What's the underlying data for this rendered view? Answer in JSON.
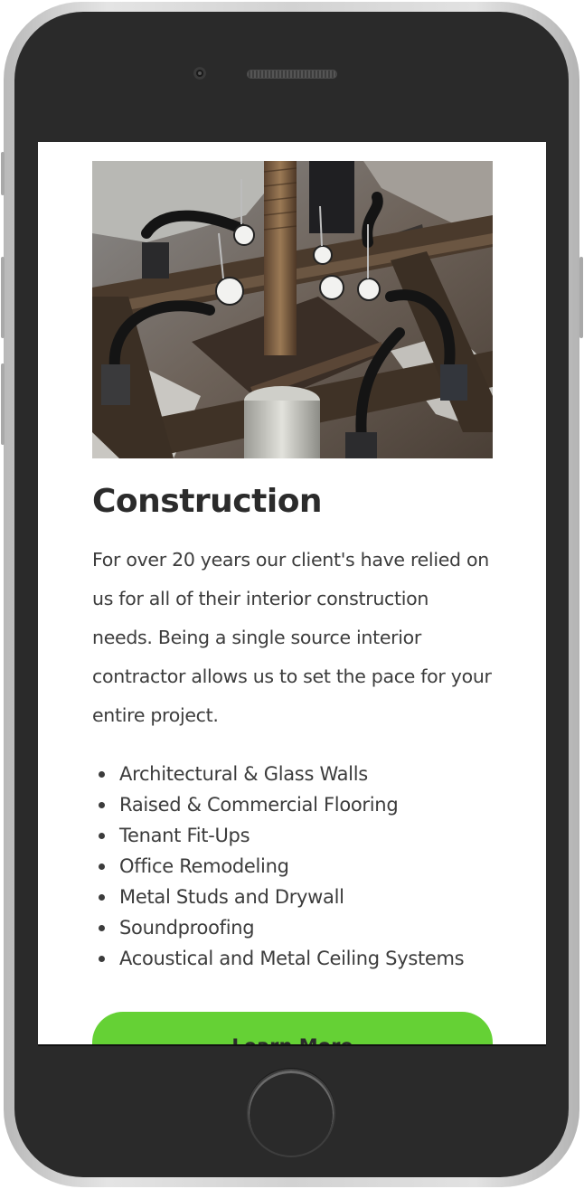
{
  "section": {
    "heading": "Construction",
    "description": "For over 20 years our client's have relied on us for all of their interior construction needs. Being a single source interior contractor allows us to set the pace for your entire project.",
    "services": [
      "Architectural & Glass Walls",
      "Raised & Commercial Flooring",
      "Tenant Fit-Ups",
      "Office Remodeling",
      "Metal Studs and Drywall",
      "Soundproofing",
      "Acoustical and Metal Ceiling Systems"
    ],
    "cta_label": "Learn More"
  },
  "colors": {
    "accent": "#65d135",
    "heading": "#2b2b2b",
    "body_text": "#3c3c3c",
    "phone_body": "#2a2a2a",
    "phone_frame": "#d2d2d2"
  },
  "icons": {
    "bullet": "bullet-dot-icon",
    "camera": "front-camera-icon",
    "home": "home-button-icon"
  }
}
